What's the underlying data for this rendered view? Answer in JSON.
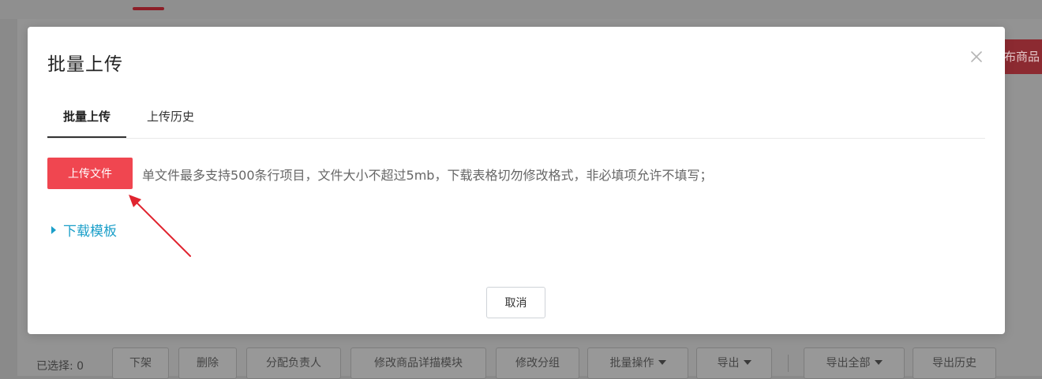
{
  "background": {
    "publish_button": "布商品",
    "toolbar": {
      "selected_label": "已选择: 0",
      "buttons": [
        "下架",
        "删除",
        "分配负责人",
        "修改商品详描模块",
        "修改分组",
        "批量操作",
        "导出",
        "导出全部",
        "导出历史"
      ]
    }
  },
  "modal": {
    "title": "批量上传",
    "close_icon": "close-icon",
    "tabs": [
      {
        "label": "批量上传",
        "active": true
      },
      {
        "label": "上传历史",
        "active": false
      }
    ],
    "upload_button": "上传文件",
    "upload_hint": "单文件最多支持500条行项目，文件大小不超过5mb，下载表格切勿修改格式，非必填项允许不填写；",
    "download_template": "下载模板",
    "cancel_button": "取消"
  },
  "colors": {
    "accent_red": "#f04650",
    "link_blue": "#1b9fc9",
    "annotation_arrow": "#e0242f"
  }
}
